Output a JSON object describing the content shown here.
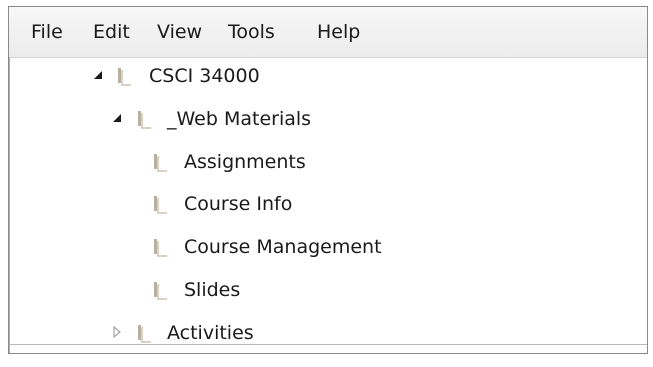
{
  "menubar": {
    "items": [
      "File",
      "Edit",
      "View",
      "Tools",
      "Help"
    ]
  },
  "tree": {
    "items": [
      {
        "label": "CSCI 34000",
        "level": 0,
        "expander": "expanded"
      },
      {
        "label": "_Web Materials",
        "level": 1,
        "expander": "expanded"
      },
      {
        "label": "Assignments",
        "level": 2,
        "expander": "none"
      },
      {
        "label": "Course Info",
        "level": 2,
        "expander": "none"
      },
      {
        "label": "Course Management",
        "level": 2,
        "expander": "none"
      },
      {
        "label": "Slides",
        "level": 2,
        "expander": "none"
      },
      {
        "label": "Activities",
        "level": 1,
        "expander": "collapsed"
      }
    ]
  },
  "colors": {
    "folder": "#d8d2c4",
    "folder_shadow": "#b8b1a1",
    "expanded_arrow": "#1a1a1a",
    "collapsed_arrow": "#a0a0a0"
  },
  "icons": {
    "expanded": "expand-down-triangle-icon",
    "collapsed": "collapse-right-triangle-icon",
    "folder": "folder-icon"
  }
}
